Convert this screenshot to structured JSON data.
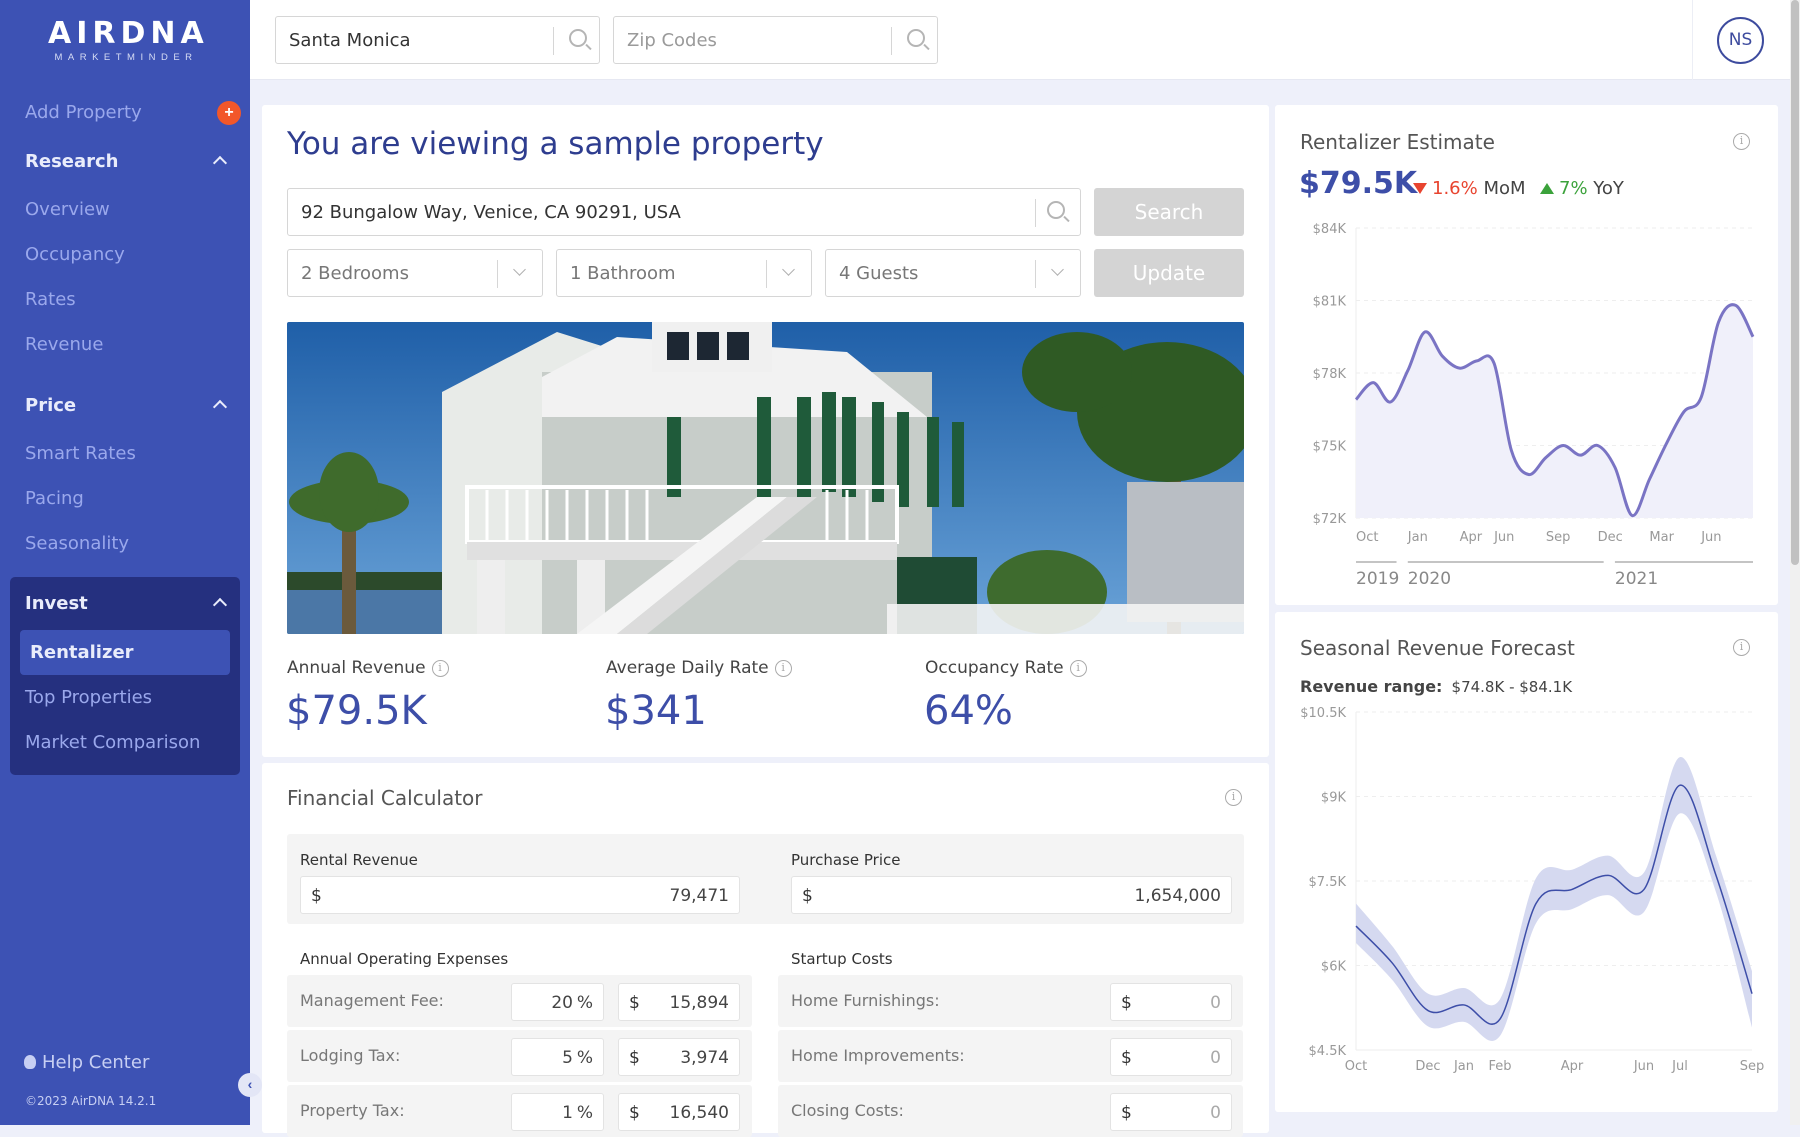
{
  "brand": {
    "name": "AIRDNA",
    "sub": "MARKETMINDER"
  },
  "sidebar": {
    "add_property": "Add Property",
    "add_badge": "+",
    "sections": [
      {
        "title": "Research",
        "items": [
          "Overview",
          "Occupancy",
          "Rates",
          "Revenue"
        ]
      },
      {
        "title": "Price",
        "items": [
          "Smart Rates",
          "Pacing",
          "Seasonality"
        ]
      },
      {
        "title": "Invest",
        "items": [
          "Rentalizer",
          "Top Properties",
          "Market Comparison"
        ],
        "active": "Rentalizer"
      }
    ],
    "help": "Help Center",
    "copyright": "©2023 AirDNA 14.2.1",
    "collapse": "‹"
  },
  "topbar": {
    "market_value": "Santa Monica",
    "zip_placeholder": "Zip Codes",
    "avatar_initials": "NS"
  },
  "property": {
    "heading": "You are viewing a sample property",
    "address": "92 Bungalow Way, Venice, CA 90291, USA",
    "search_label": "Search",
    "bedrooms": "2 Bedrooms",
    "bathrooms": "1 Bathroom",
    "guests": "4 Guests",
    "update_label": "Update",
    "metrics": [
      {
        "label": "Annual Revenue",
        "value": "$79.5K"
      },
      {
        "label": "Average Daily Rate",
        "value": "$341"
      },
      {
        "label": "Occupancy Rate",
        "value": "64%"
      }
    ]
  },
  "calculator": {
    "title": "Financial Calculator",
    "rental_revenue_label": "Rental Revenue",
    "rental_revenue_prefix": "$",
    "rental_revenue": "79,471",
    "purchase_price_label": "Purchase Price",
    "purchase_price_prefix": "$",
    "purchase_price": "1,654,000",
    "opex_title": "Annual Operating Expenses",
    "opex": [
      {
        "label": "Management Fee:",
        "pct": "20",
        "amount": "15,894"
      },
      {
        "label": "Lodging Tax:",
        "pct": "5",
        "amount": "3,974"
      },
      {
        "label": "Property Tax:",
        "pct": "1",
        "amount": "16,540"
      }
    ],
    "startup_title": "Startup Costs",
    "startup": [
      {
        "label": "Home Furnishings:",
        "amount": "0"
      },
      {
        "label": "Home Improvements:",
        "amount": "0"
      },
      {
        "label": "Closing Costs:",
        "amount": "0"
      }
    ],
    "pct_symbol": "%",
    "dollar_symbol": "$"
  },
  "estimate": {
    "title": "Rentalizer Estimate",
    "value": "$79.5K",
    "mom_value": "1.6%",
    "mom_label": "MoM",
    "yoy_value": "7%",
    "yoy_label": "YoY"
  },
  "forecast": {
    "title": "Seasonal Revenue Forecast",
    "range_label": "Revenue range:",
    "range_value": "$74.8K - $84.1K"
  },
  "colors": {
    "accent": "#3d52b4",
    "title": "#2e3d8f",
    "down": "#e8442f",
    "up": "#3ba23b",
    "line": "#7a74c4",
    "forecast_line": "#3d4ea8",
    "badge": "#f2572a"
  },
  "chart_data": [
    {
      "type": "area",
      "title": "Rentalizer Estimate",
      "ylim": [
        72000,
        84000
      ],
      "yticks": [
        "$72K",
        "$75K",
        "$78K",
        "$81K",
        "$84K"
      ],
      "ytick_values": [
        72000,
        75000,
        78000,
        81000,
        84000
      ],
      "xticks": [
        {
          "label": "Oct",
          "i": 0
        },
        {
          "label": "Jan",
          "i": 3
        },
        {
          "label": "Apr",
          "i": 6
        },
        {
          "label": "Jun",
          "i": 8
        },
        {
          "label": "Sep",
          "i": 11
        },
        {
          "label": "Dec",
          "i": 14
        },
        {
          "label": "Mar",
          "i": 17
        },
        {
          "label": "Jun",
          "i": 20
        }
      ],
      "year_labels": [
        {
          "label": "2019",
          "from": 0,
          "to": 2
        },
        {
          "label": "2020",
          "from": 3,
          "to": 14
        },
        {
          "label": "2021",
          "from": 15,
          "to": 23
        }
      ],
      "x": [
        "2019-10",
        "2019-11",
        "2019-12",
        "2020-01",
        "2020-02",
        "2020-03",
        "2020-04",
        "2020-05",
        "2020-06",
        "2020-07",
        "2020-08",
        "2020-09",
        "2020-10",
        "2020-11",
        "2020-12",
        "2021-01",
        "2021-02",
        "2021-03",
        "2021-04",
        "2021-05",
        "2021-06",
        "2021-07",
        "2021-08",
        "2021-09"
      ],
      "values": [
        76900,
        77600,
        76800,
        78100,
        79700,
        78700,
        78200,
        78500,
        78400,
        74800,
        73800,
        74500,
        75000,
        74600,
        75000,
        74100,
        72100,
        73600,
        75100,
        76400,
        77000,
        80100,
        80800,
        79500
      ],
      "grid": true
    },
    {
      "type": "line",
      "title": "Seasonal Revenue Forecast",
      "ylim": [
        4500,
        10500
      ],
      "yticks": [
        "$4.5K",
        "$6K",
        "$7.5K",
        "$9K",
        "$10.5K"
      ],
      "ytick_values": [
        4500,
        6000,
        7500,
        9000,
        10500
      ],
      "x": [
        "Oct",
        "Nov",
        "Dec",
        "Jan",
        "Feb",
        "Mar",
        "Apr",
        "May",
        "Jun",
        "Jul",
        "Aug",
        "Sep"
      ],
      "xticks": [
        "Oct",
        "Dec",
        "Jan",
        "Feb",
        "Apr",
        "Jun",
        "Jul",
        "Sep"
      ],
      "values": [
        6700,
        6050,
        5200,
        5300,
        5050,
        7100,
        7350,
        7600,
        7350,
        9200,
        7600,
        5500
      ],
      "lower": [
        6400,
        5750,
        4920,
        5000,
        4750,
        6750,
        7000,
        7250,
        6950,
        8700,
        7300,
        4900
      ],
      "upper": [
        7100,
        6350,
        5500,
        5600,
        5400,
        7550,
        7700,
        7950,
        7650,
        9700,
        7950,
        5900
      ],
      "grid": true
    }
  ]
}
